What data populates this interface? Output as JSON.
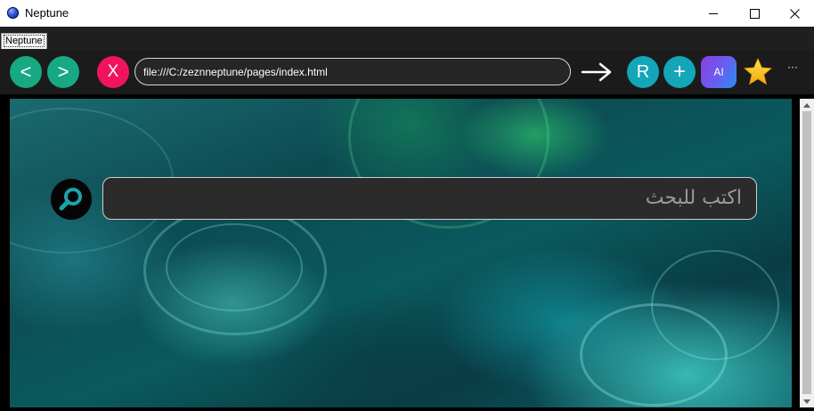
{
  "window": {
    "title": "Neptune",
    "icon": "neptune-globe-icon",
    "controls": [
      "minimize-icon",
      "maximize-icon",
      "close-icon"
    ]
  },
  "tabs": [
    {
      "label": "Neptune",
      "active": true
    }
  ],
  "toolbar": {
    "back_label": "<",
    "forward_label": ">",
    "stop_label": "X",
    "address": "file:///C:/zeznneptune/pages/index.html",
    "go_icon": "arrow-right-icon",
    "reload_label": "R",
    "newtab_label": "+",
    "ai_label": "AI",
    "favorite_icon": "star-icon",
    "more_label": "···",
    "colors": {
      "nav": "#17a884",
      "stop": "#f2135d",
      "action": "#12a6b8",
      "star": "#f6c21a"
    }
  },
  "page": {
    "search": {
      "placeholder": "اكتب للبحث",
      "icon": "search-icon"
    }
  }
}
